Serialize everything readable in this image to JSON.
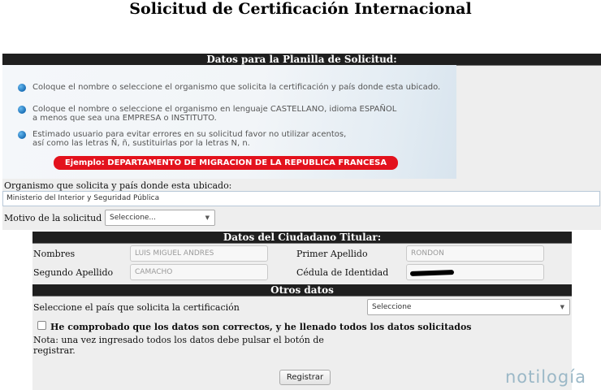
{
  "page": {
    "title": "Solicitud de Certificación Internacional"
  },
  "planilla": {
    "header": "Datos para la Planilla de Solicitud:",
    "instructions": [
      "Coloque el nombre o seleccione el organismo que solicita la certificación y país donde esta ubicado.",
      "Coloque el nombre o seleccione el organismo en lenguaje CASTELLANO, idioma ESPAÑOL\na menos que sea una EMPRESA o INSTITUTO.",
      "Estimado usuario para evitar errores en su solicitud favor no utilizar acentos,\nasí como las letras Ñ, ñ, sustituirlas por la letras N, n."
    ],
    "example": "Ejemplo: DEPARTAMENTO DE MIGRACION DE LA REPUBLICA FRANCESA",
    "organismo_label": "Organismo que solicita y país donde esta ubicado:",
    "organismo_value": "Ministerio del Interior y Seguridad Pública",
    "motivo_label": "Motivo de la solicitud",
    "motivo_value": "Seleccione..."
  },
  "citizen": {
    "header": "Datos del Ciudadano Titular:",
    "nombres_label": "Nombres",
    "nombres_value": "LUIS MIGUEL ANDRES",
    "primer_apellido_label": "Primer Apellido",
    "primer_apellido_value": "RONDON",
    "segundo_apellido_label": "Segundo Apellido",
    "segundo_apellido_value": "CAMACHO",
    "cedula_label": "Cédula de Identidad"
  },
  "otros": {
    "header": "Otros datos",
    "pais_label": "Seleccione el país que solicita la certificación",
    "pais_value": "Seleccione",
    "confirm_label": "He comprobado que los datos son correctos, y he llenado todos los datos solicitados",
    "note": "Nota: una vez ingresado todos los datos debe pulsar el botón de\nregistrar.",
    "register_button": "Registrar"
  },
  "watermark": "notilogía",
  "colors": {
    "header_bar": "#1f1f1f",
    "example_badge": "#e3121d",
    "bullet": "#1a6fb6",
    "panel": "#eeeeee"
  }
}
